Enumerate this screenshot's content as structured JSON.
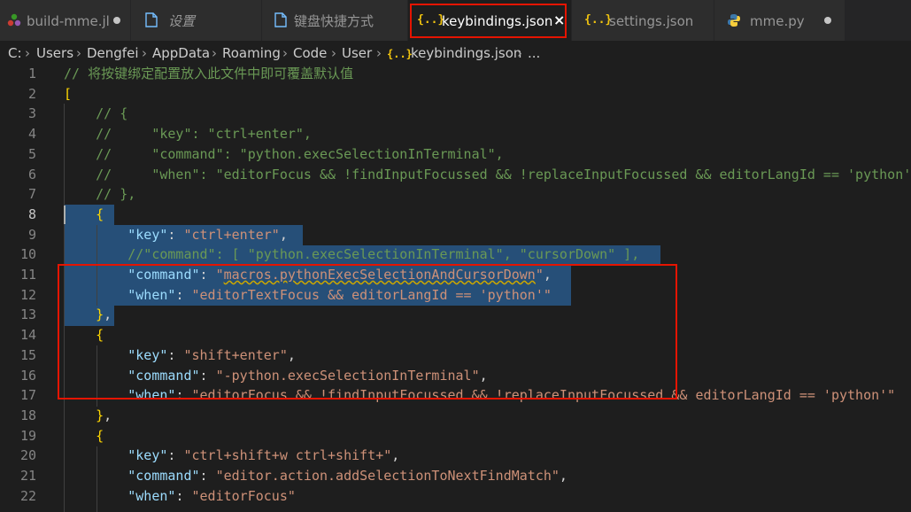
{
  "tabs": [
    {
      "label": "build-mme.jl",
      "icon": "julia-icon",
      "italic": false,
      "dirty": true
    },
    {
      "label": "设置",
      "icon": "file-icon",
      "italic": true,
      "dirty": false
    },
    {
      "label": "键盘快捷方式",
      "icon": "file-icon",
      "italic": false,
      "dirty": false
    },
    {
      "label": "keybindings.json",
      "icon": "json-icon",
      "italic": false,
      "active": true,
      "close": "×"
    },
    {
      "label": "settings.json",
      "icon": "json-icon",
      "italic": false,
      "dirty": false
    },
    {
      "label": "mme.py",
      "icon": "python-icon",
      "italic": false,
      "dirty": true
    }
  ],
  "breadcrumb": [
    "C:",
    "Users",
    "Dengfei",
    "AppData",
    "Roaming",
    "Code",
    "User",
    "keybindings.json",
    "..."
  ],
  "line_numbers": [
    "1",
    "2",
    "3",
    "4",
    "5",
    "6",
    "7",
    "8",
    "9",
    "10",
    "11",
    "12",
    "13",
    "14",
    "15",
    "16",
    "17",
    "18",
    "19",
    "20",
    "21",
    "22"
  ],
  "code_lines": [
    "// 将按键绑定配置放入此文件中即可覆盖默认值",
    "[",
    "    // {",
    "    //     \"key\": \"ctrl+enter\",",
    "    //     \"command\": \"python.execSelectionInTerminal\",",
    "    //     \"when\": \"editorFocus && !findInputFocussed && !replaceInputFocussed && editorLangId == 'python'\"",
    "    // },",
    "    {",
    "        \"key\": \"ctrl+enter\",",
    "        //\"command\": [ \"python.execSelectionInTerminal\", \"cursorDown\" ],",
    "        \"command\": \"macros.pythonExecSelectionAndCursorDown\",",
    "        \"when\": \"editorTextFocus && editorLangId == 'python'\"",
    "    },",
    "    {",
    "        \"key\": \"shift+enter\",",
    "        \"command\": \"-python.execSelectionInTerminal\",",
    "        \"when\": \"editorFocus && !findInputFocussed && !replaceInputFocussed && editorLangId == 'python'\"",
    "    },",
    "    {",
    "        \"key\": \"ctrl+shift+w ctrl+shift+\",",
    "        \"command\": \"editor.action.addSelectionToNextFindMatch\",",
    "        \"when\": \"editorFocus\""
  ],
  "colors": {
    "selection": "#264f78",
    "highlight_box": "#e51400",
    "comment": "#6a9955",
    "json_key": "#9cdcfe",
    "json_string": "#ce9178"
  }
}
